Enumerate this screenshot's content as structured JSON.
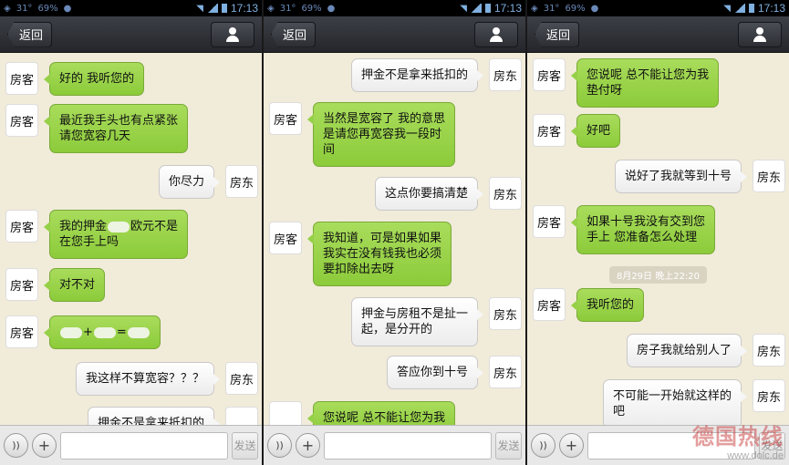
{
  "status_bar": {
    "left_icons": [
      "shield-icon",
      "temperature-icon",
      "battery-saver-icon",
      "wechat-icon"
    ],
    "temp": "31°",
    "percent": "69%",
    "time": "17:13"
  },
  "header": {
    "back_label": "返回",
    "profile_icon": "person-icon"
  },
  "input_bar": {
    "voice_icon": "voice-icon",
    "plus_icon": "plus-icon",
    "placeholder": "",
    "send_label": "发送"
  },
  "screens": [
    {
      "messages": [
        {
          "side": "left",
          "avatar": "房客",
          "text": "好的 我听您的"
        },
        {
          "side": "left",
          "avatar": "房客",
          "text": "最近我手头也有点紧张\n请您宽容几天"
        },
        {
          "side": "right",
          "avatar": "房东",
          "text": "你尽力"
        },
        {
          "side": "left",
          "avatar": "房客",
          "text": "我的押金[*]欧元不是\n在您手上吗"
        },
        {
          "side": "left",
          "avatar": "房客",
          "text": "对不对"
        },
        {
          "side": "left",
          "avatar": "房客",
          "text": "[*]+[*]=[*]"
        },
        {
          "side": "right",
          "avatar": "房东",
          "text": "我这样不算宽容？？？"
        },
        {
          "side": "right",
          "avatar": "",
          "text": "押金不是拿来抵扣的"
        }
      ]
    },
    {
      "messages": [
        {
          "side": "right",
          "avatar": "房东",
          "text": "押金不是拿来抵扣的"
        },
        {
          "side": "left",
          "avatar": "房客",
          "text": "当然是宽容了 我的意思\n是请您再宽容我一段时\n间"
        },
        {
          "side": "right",
          "avatar": "房东",
          "text": "这点你要搞清楚"
        },
        {
          "side": "left",
          "avatar": "房客",
          "text": "我知道，可是如果如果\n我实在没有钱我也必须\n要扣除出去呀"
        },
        {
          "side": "right",
          "avatar": "房东",
          "text": "押金与房租不是扯一\n起，是分开的"
        },
        {
          "side": "right",
          "avatar": "房东",
          "text": "答应你到十号"
        },
        {
          "side": "left",
          "avatar": "",
          "text": "您说呢 总不能让您为我"
        }
      ]
    },
    {
      "messages": [
        {
          "side": "left",
          "avatar": "房客",
          "text": "您说呢 总不能让您为我\n垫付呀"
        },
        {
          "side": "left",
          "avatar": "房客",
          "text": "好吧"
        },
        {
          "side": "right",
          "avatar": "房东",
          "text": "说好了我就等到十号"
        },
        {
          "side": "left",
          "avatar": "房客",
          "text": "如果十号我没有交到您\n手上 您准备怎么处理"
        },
        {
          "side": "time",
          "text": "8月29日 晚上22:20"
        },
        {
          "side": "left",
          "avatar": "房客",
          "text": "我听您的"
        },
        {
          "side": "right",
          "avatar": "房东",
          "text": "房子我就给别人了"
        },
        {
          "side": "right",
          "avatar": "房东",
          "text": "不可能一开始就这样的\n吧"
        }
      ]
    }
  ],
  "watermark": {
    "line1": "德国热线",
    "line2": "www.dolc.de"
  }
}
